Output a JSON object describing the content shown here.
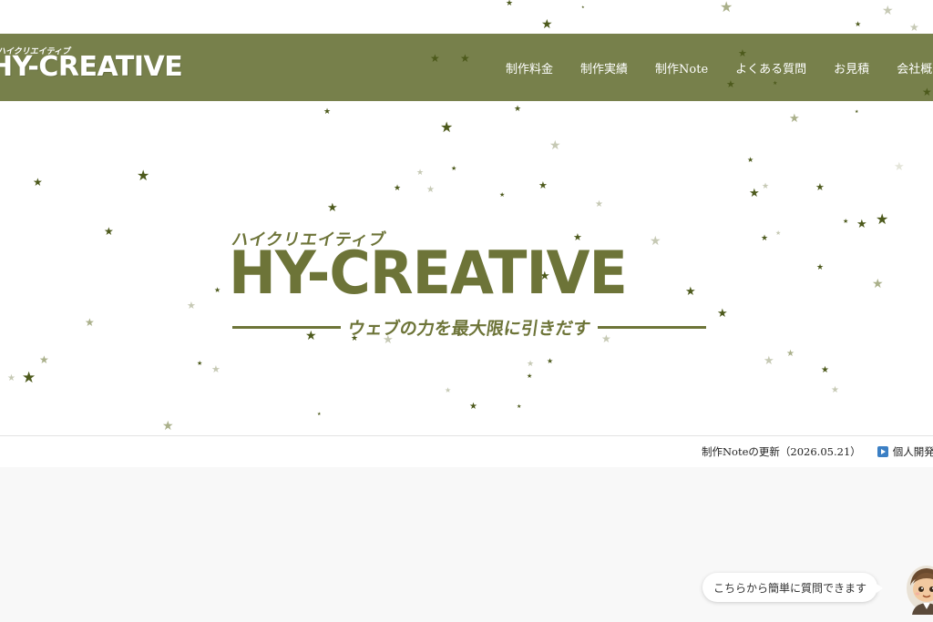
{
  "header": {
    "logo_kana": "ハイクリエイティブ",
    "logo_text": "HY-CREATIVE",
    "nav": [
      "制作料金",
      "制作実績",
      "制作Note",
      "よくある質問",
      "お見積",
      "会社概要"
    ]
  },
  "hero": {
    "kana": "ハイクリエイティブ",
    "title": "HY-CREATIVE",
    "tagline": "ウェブの力を最大限に引きだす"
  },
  "ticker": {
    "update_text": "制作Noteの更新（2026.05.21）",
    "item_text": "個人開発者向けのサービス"
  },
  "chat": {
    "bubble_text": "こちらから簡単に質問できます"
  },
  "colors": {
    "brand": "#77804b",
    "hero_text": "#6d7438",
    "star_dark": "#4d5a1c",
    "star_light": "#c6c9b4",
    "ticker_icon": "#3b7fc4"
  },
  "icons": {
    "stars": "star-icon",
    "ticker": "play-icon",
    "chat": "assistant-avatar"
  }
}
